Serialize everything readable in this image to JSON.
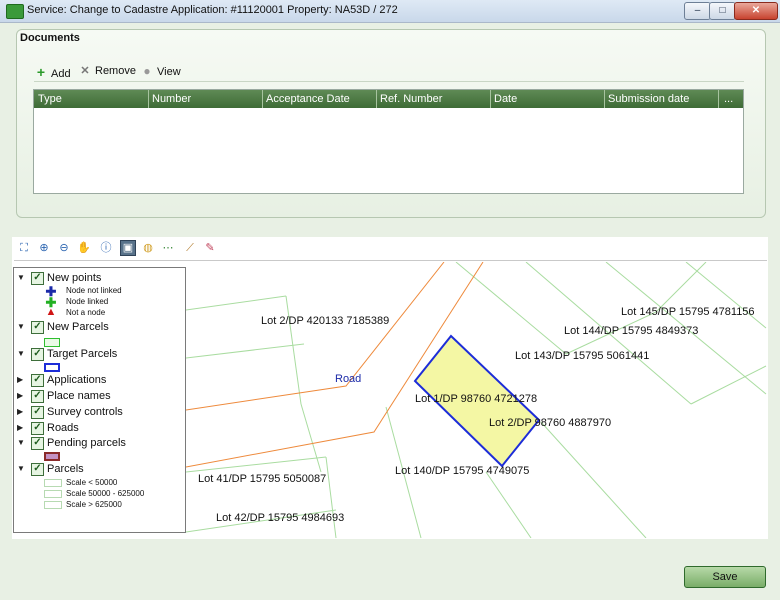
{
  "window": {
    "title": "Service: Change to Cadastre  Application: #11120001  Property: NA53D / 272",
    "minimize_glyph": "–",
    "maximize_glyph": "□",
    "close_glyph": "✕"
  },
  "documents": {
    "legend": "Documents",
    "toolbar": {
      "add_label": "Add",
      "remove_label": "Remove",
      "view_label": "View"
    },
    "columns": [
      "Type",
      "Number",
      "Acceptance Date",
      "Ref. Number",
      "Date",
      "Submission date",
      "..."
    ]
  },
  "map": {
    "tools": [
      "zoom-extent",
      "zoom-in",
      "zoom-out",
      "pan",
      "info",
      "select",
      "measure",
      "snap",
      "edit",
      "erase"
    ],
    "layers": [
      {
        "label": "New points",
        "expanded": true,
        "checked": true
      },
      {
        "label": "New Parcels",
        "expanded": true,
        "checked": true
      },
      {
        "label": "Target Parcels",
        "expanded": true,
        "checked": true
      },
      {
        "label": "Applications",
        "expanded": false,
        "checked": true
      },
      {
        "label": "Place names",
        "expanded": false,
        "checked": true
      },
      {
        "label": "Survey controls",
        "expanded": false,
        "checked": true
      },
      {
        "label": "Roads",
        "expanded": false,
        "checked": true
      },
      {
        "label": "Pending parcels",
        "expanded": true,
        "checked": true
      },
      {
        "label": "Parcels",
        "expanded": true,
        "checked": true
      }
    ],
    "new_points_legend": [
      "Node not linked",
      "Node linked",
      "Not a node"
    ],
    "parcels_legend": [
      "Scale < 50000",
      "Scale 50000 - 625000",
      "Scale > 625000"
    ],
    "labels": {
      "lot_145": "Lot 145/DP 15795 4781156",
      "lot_144": "Lot 144/DP 15795 4849373",
      "lot_143": "Lot 143/DP 15795 5061441",
      "lot_2_dp420133": "Lot 2/DP 420133 7185389",
      "road": "Road",
      "lot_1": "Lot 1/DP 98760 4721278",
      "lot_2_dp98760": "Lot 2/DP 98760 4887970",
      "lot_140": "Lot 140/DP 15795 4749075",
      "lot_41": "Lot 41/DP 15795 5050087",
      "lot_42": "Lot 42/DP 15795 4984693"
    },
    "colors": {
      "road": "#ee8a3c",
      "parcel_line": "#a9dca0",
      "target_fill": "#f4f7a4",
      "target_outline": "#1d2dd8",
      "new_parcel": "#9fe39a",
      "pending_fill": "#c492c4",
      "pending_outline": "#8a2a2a"
    }
  },
  "footer": {
    "save_label": "Save"
  }
}
